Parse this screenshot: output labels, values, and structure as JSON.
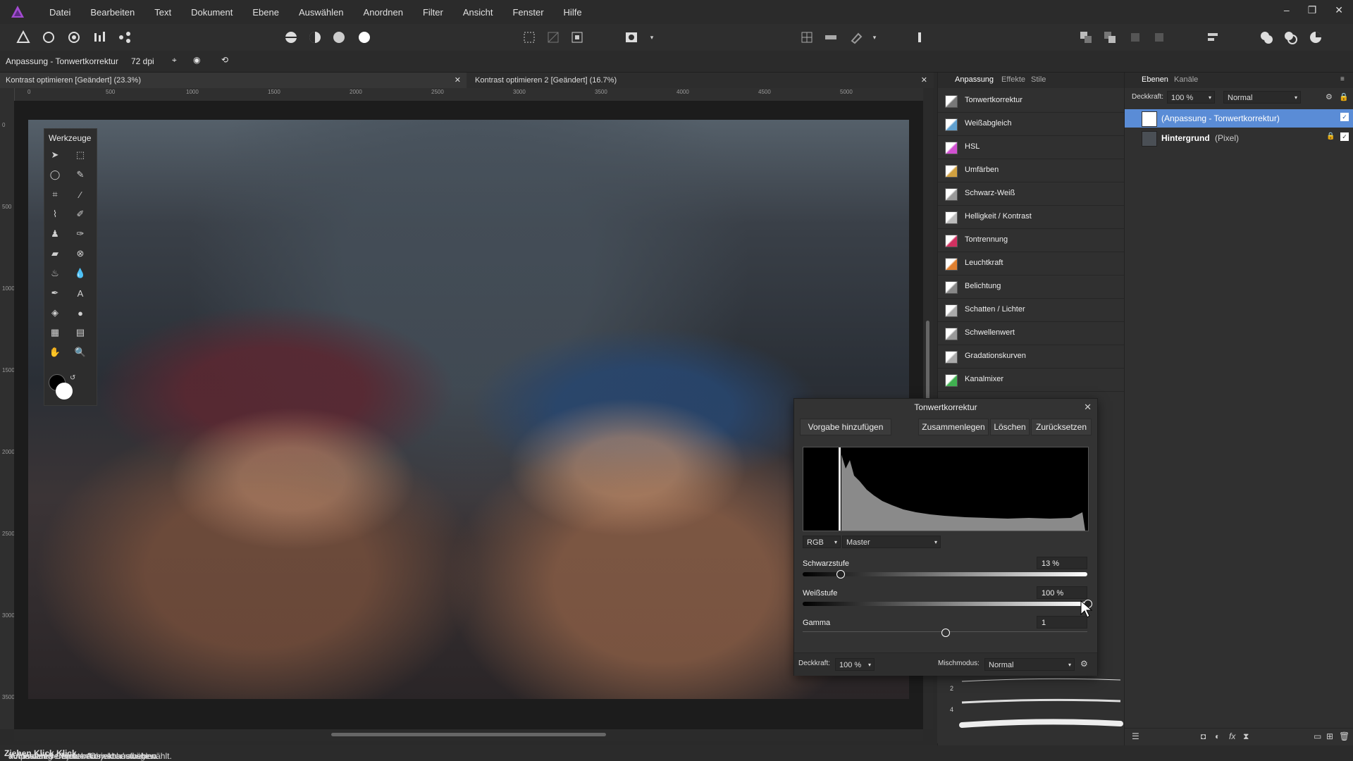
{
  "menubar": {
    "items": [
      "Datei",
      "Bearbeiten",
      "Text",
      "Dokument",
      "Ebene",
      "Auswählen",
      "Anordnen",
      "Filter",
      "Ansicht",
      "Fenster",
      "Hilfe"
    ]
  },
  "context": {
    "layer_name": "Anpassung - Tonwertkorrektur",
    "dpi": "72 dpi"
  },
  "tabs": [
    {
      "label": "Kontrast optimieren [Geändert] (23.3%)"
    },
    {
      "label": "Kontrast optimieren 2 [Geändert] (16.7%)"
    }
  ],
  "ruler": {
    "top_labels": [
      "0",
      "500",
      "1000",
      "1500",
      "2000",
      "2500",
      "3000",
      "3500",
      "4000",
      "4500",
      "5000"
    ],
    "left_labels": [
      "0",
      "500",
      "1000",
      "1500",
      "2000",
      "2500",
      "3000",
      "3500"
    ]
  },
  "tools": {
    "title": "Werkzeuge"
  },
  "adjustment_panel": {
    "tabs": [
      "Anpassung",
      "Effekte",
      "Stile"
    ],
    "items": [
      {
        "label": "Tonwertkorrektur",
        "color": "#777777"
      },
      {
        "label": "Weißabgleich",
        "color": "#5fa0d0"
      },
      {
        "label": "HSL",
        "color": "#d050d0"
      },
      {
        "label": "Umfärben",
        "color": "#d0a040"
      },
      {
        "label": "Schwarz-Weiß",
        "color": "#999999"
      },
      {
        "label": "Helligkeit / Kontrast",
        "color": "#bbbbbb"
      },
      {
        "label": "Tontrennung",
        "color": "#d03060"
      },
      {
        "label": "Leuchtkraft",
        "color": "#e08030"
      },
      {
        "label": "Belichtung",
        "color": "#888888"
      },
      {
        "label": "Schatten / Lichter",
        "color": "#aaaaaa"
      },
      {
        "label": "Schwellenwert",
        "color": "#999999"
      },
      {
        "label": "Gradationskurven",
        "color": "#aaaaaa"
      },
      {
        "label": "Kanalmixer",
        "color": "#40b050"
      }
    ]
  },
  "layers_panel": {
    "tabs": [
      "Ebenen",
      "Kanäle"
    ],
    "opacity_label": "Deckkraft:",
    "opacity_value": "100 %",
    "blend_mode": "Normal",
    "layers": [
      {
        "name": "(Anpassung - Tonwertkorrektur)",
        "type": ""
      },
      {
        "name": "Hintergrund",
        "type": "(Pixel)"
      }
    ]
  },
  "dialog": {
    "title": "Tonwertkorrektur",
    "buttons": [
      "Vorgabe hinzufügen",
      "Zusammenlegen",
      "Löschen",
      "Zurücksetzen"
    ],
    "channel_mode": "RGB",
    "channel": "Master",
    "black_label": "Schwarzstufe",
    "black_value": "13 %",
    "black_level": 0.13,
    "white_label": "Weißstufe",
    "white_value": "100 %",
    "white_level": 1.0,
    "gamma_label": "Gamma",
    "gamma_value": "1",
    "gamma_level": 0.5,
    "opacity_label": "Deckkraft:",
    "opacity_value": "100 %",
    "blend_label": "Mischmodus:",
    "blend_value": "Normal"
  },
  "brush_sizes": [
    "2",
    "4"
  ],
  "status": {
    "prefix": "'Anpassung - Tonwertkorrektur' ausgewählt.",
    "b1": "Ziehen",
    "t1": "= Auswahl verschieben.",
    "b2": "Klick",
    "t2": "auf anderes Objekt = Objekt auswählen.",
    "b3": "Klick",
    "t3": "auf leeren Bereich = Auswahl aufheben."
  }
}
